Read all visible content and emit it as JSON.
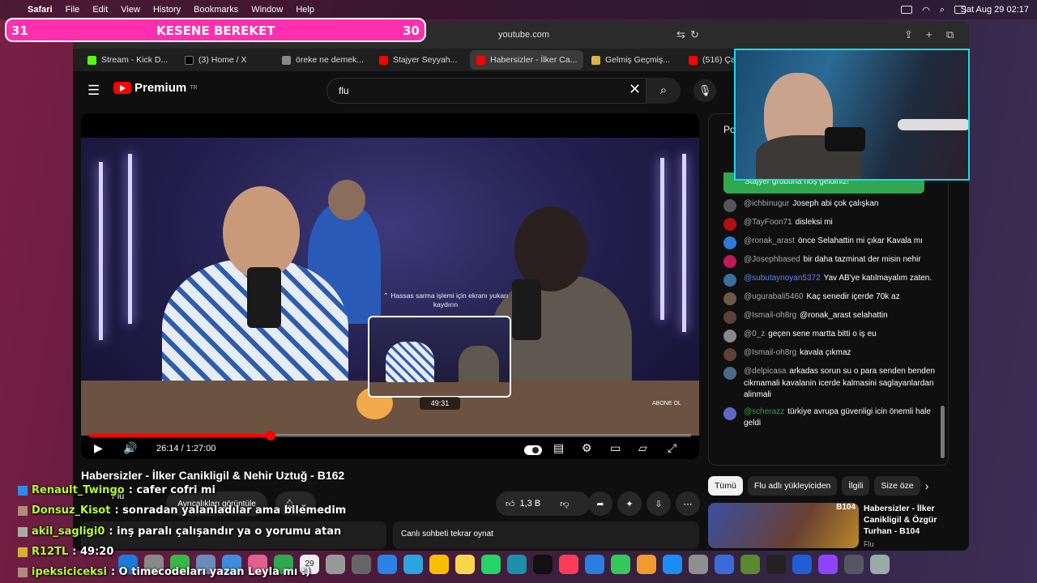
{
  "menubar": {
    "app": "Safari",
    "items": [
      "File",
      "Edit",
      "View",
      "History",
      "Bookmarks",
      "Window",
      "Help"
    ],
    "clock": "Sat Aug 29  02:17"
  },
  "browser": {
    "url": "youtube.com",
    "tabs": [
      {
        "label": "Stream - Kick D...",
        "color": "#53fc18"
      },
      {
        "label": "(3) Home / X",
        "color": "#000000"
      },
      {
        "label": "öreke ne demek...",
        "color": "#888888"
      },
      {
        "label": "Stajyer Seyyah...",
        "color": "#ff0000"
      },
      {
        "label": "Habersizler - İlker Ca...",
        "color": "#ff0000"
      },
      {
        "label": "Gelmiş Geçmiş...",
        "color": "#d9b44a"
      },
      {
        "label": "(516) Ça",
        "color": "#ff0000"
      }
    ]
  },
  "youtube": {
    "logo": "Premium",
    "logo_sup": "TR",
    "search_value": "flu",
    "player": {
      "scrub_hint": "Hassas sarma işlemi için ekranı yukarı kaydırın",
      "preview_time": "49:31",
      "time": "26:14 / 1:27:00",
      "progress": 0.302,
      "hover": 0.569,
      "watermark": "ABONE OL"
    },
    "video_title": "Habersizler - İlker Canikligil & Nehir Uztuğ - B162",
    "channel": "Flu",
    "subscribe_label": "Ayrıcalıkları görüntüle",
    "like_count": "1,3 B",
    "desc_snippet": "...",
    "replay_label": "Canlı sohbeti tekrar oynat",
    "chat_header": "Po",
    "chat_welcome": "Stajyer grubuna hoş geldiniz!",
    "chat": [
      {
        "author": "@ichbinugur",
        "text": "Joseph abi çok çalışkan",
        "av": "#555555",
        "type": "normal"
      },
      {
        "author": "@TayFoon71",
        "text": "disleksi mi",
        "av": "#b01010",
        "type": "normal"
      },
      {
        "author": "@ronak_arast",
        "text": "önce Selahattin mi çıkar Kavala mı",
        "av": "#2f7ad8",
        "type": "normal"
      },
      {
        "author": "@Josephbased",
        "text": "bir daha tazminat der misin nehir",
        "av": "#c2185b",
        "type": "normal"
      },
      {
        "author": "@subutaynoyan5372",
        "text": "Yav AB'ye katılmayalım zaten.",
        "av": "#3a6e9c",
        "type": "mod"
      },
      {
        "author": "@ugurabali5460",
        "text": "Kaç senedir içerde 70k az",
        "av": "#6a5a4a",
        "type": "normal"
      },
      {
        "author": "@Ismail-oh8rg",
        "text": "@ronak_arast selahattin",
        "av": "#5d4037",
        "type": "normal"
      },
      {
        "author": "@0_z",
        "text": "geçen sene martta bitti o iş eu",
        "av": "#888888",
        "type": "normal"
      },
      {
        "author": "@Ismail-oh8rg",
        "text": "kavala çıkmaz",
        "av": "#5d4037",
        "type": "normal"
      },
      {
        "author": "@delpicasa",
        "text": "arkadas sorun su o para senden benden cikmamali kavalanin icerde kalmasini saglayanlardan alinmali",
        "av": "#4a6a8a",
        "type": "normal"
      },
      {
        "author": "@scherazz",
        "text": "türkiye avrupa güvenligi icin önemli hale geldi",
        "av": "#5c6bc0",
        "type": "mem"
      }
    ],
    "chips": [
      "Tümü",
      "Flu adlı yükleyiciden",
      "İlgili",
      "Size öze"
    ],
    "rec": {
      "title": "Habersizler - İlker Canikligil & Özgür Turhan  - B104",
      "channel": "Flu",
      "badge": "B104"
    }
  },
  "overlay": {
    "banner_left": "31",
    "banner_title": "KESENE BEREKET",
    "banner_right": "30",
    "messages": [
      {
        "name": "Renault_Twingo",
        "text": ": cafer cofri mi"
      },
      {
        "name": "Donsuz_Kisot",
        "text": ": sonradan yalanladılar ama bilemedim"
      },
      {
        "name": "akil_sagligi0",
        "text": ": inş paralı çalışandır ya o yorumu atan"
      },
      {
        "name": "R12TL",
        "text": ": 49:20"
      },
      {
        "name": "ipeksiciceksi",
        "text": ": O timecodeları yazan Leyla mı :)"
      }
    ]
  },
  "dock": {
    "date": "29"
  }
}
